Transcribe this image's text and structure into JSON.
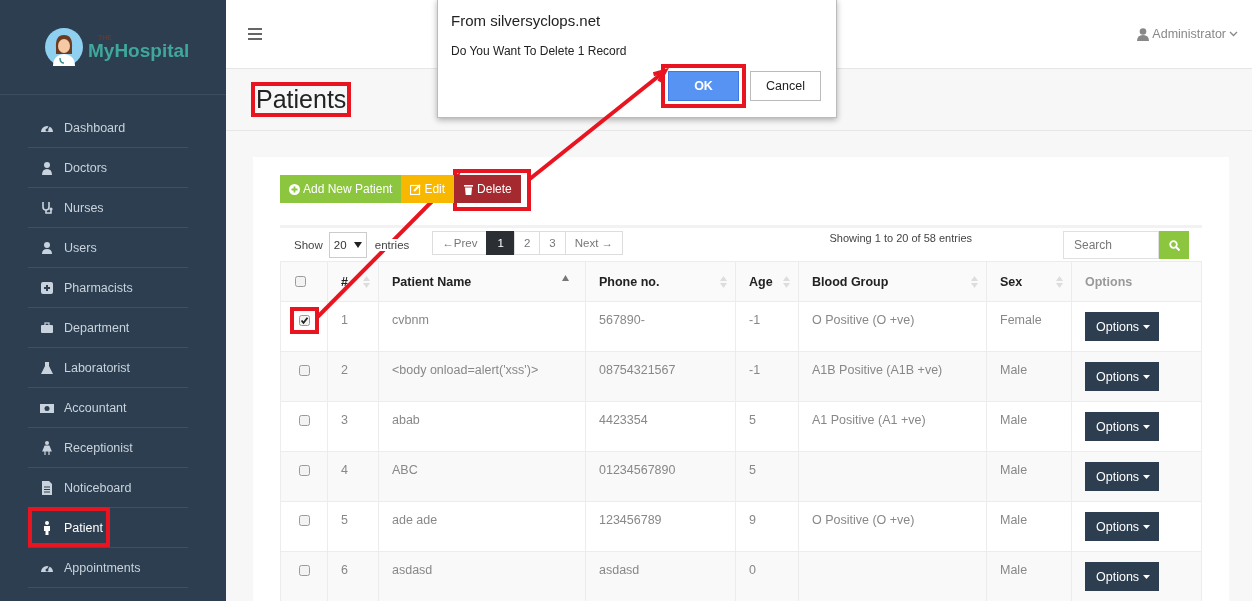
{
  "sidebar": {
    "logo": {
      "tagline": "THE",
      "text": "MyHospital"
    },
    "items": [
      {
        "label": "Dashboard",
        "selected": false,
        "highlighted": false
      },
      {
        "label": "Doctors",
        "selected": false,
        "highlighted": false
      },
      {
        "label": "Nurses",
        "selected": false,
        "highlighted": false
      },
      {
        "label": "Users",
        "selected": false,
        "highlighted": false
      },
      {
        "label": "Pharmacists",
        "selected": false,
        "highlighted": false
      },
      {
        "label": "Department",
        "selected": false,
        "highlighted": false
      },
      {
        "label": "Laboratorist",
        "selected": false,
        "highlighted": false
      },
      {
        "label": "Accountant",
        "selected": false,
        "highlighted": false
      },
      {
        "label": "Receptionist",
        "selected": false,
        "highlighted": false
      },
      {
        "label": "Noticeboard",
        "selected": false,
        "highlighted": false
      },
      {
        "label": "Patient",
        "selected": true,
        "highlighted": true
      },
      {
        "label": "Appointments",
        "selected": false,
        "highlighted": false
      }
    ]
  },
  "topbar": {
    "user": "Administrator"
  },
  "page": {
    "title": "Patients",
    "highlighted": true
  },
  "toolbar": [
    {
      "kind": "add",
      "label": "Add New Patient",
      "highlighted": false,
      "arrow": false
    },
    {
      "kind": "edit",
      "label": "Edit",
      "highlighted": false,
      "arrow": false
    },
    {
      "kind": "delete",
      "label": "Delete",
      "highlighted": true,
      "arrow": true
    }
  ],
  "length_menu": {
    "before": "Show",
    "value": "20",
    "after": "entries"
  },
  "pagination": [
    {
      "label": "←Prev",
      "selected": false
    },
    {
      "label": "1",
      "selected": true
    },
    {
      "label": "2",
      "selected": false
    },
    {
      "label": "3",
      "selected": false
    },
    {
      "label": "Next →",
      "selected": false
    }
  ],
  "info": "Showing 1 to 20 of 58 entries",
  "search": {
    "placeholder": "Search"
  },
  "table": {
    "select_all": {
      "checked": false
    },
    "columns": [
      {
        "kind": "text",
        "label": "#",
        "sortable": true,
        "sorted": false
      },
      {
        "kind": "text",
        "label": "Patient Name",
        "sortable": true,
        "sorted": true
      },
      {
        "kind": "text",
        "label": "Phone no.",
        "sortable": true,
        "sorted": false
      },
      {
        "kind": "text",
        "label": "Age",
        "sortable": true,
        "sorted": false
      },
      {
        "kind": "text",
        "label": "Blood Group",
        "sortable": true,
        "sorted": false
      },
      {
        "kind": "text",
        "label": "Sex",
        "sortable": true,
        "sorted": false
      },
      {
        "kind": "muted",
        "label": "Options",
        "sortable": false,
        "sorted": false
      }
    ],
    "rows": [
      {
        "checked": true,
        "highlighted": true,
        "arrow": true,
        "cells": [
          "1",
          "cvbnm",
          "567890-",
          "-1",
          "O Positive (O +ve)",
          "Female"
        ],
        "action": "Options"
      },
      {
        "checked": false,
        "highlighted": false,
        "arrow": false,
        "cells": [
          "2",
          "<body onload=alert('xss')>",
          "08754321567",
          "-1",
          "A1B Positive (A1B +ve)",
          "Male"
        ],
        "action": "Options"
      },
      {
        "checked": false,
        "highlighted": false,
        "arrow": false,
        "cells": [
          "3",
          "abab",
          "4423354",
          "5",
          "A1 Positive (A1 +ve)",
          "Male"
        ],
        "action": "Options"
      },
      {
        "checked": false,
        "highlighted": false,
        "arrow": false,
        "cells": [
          "4",
          "ABC",
          "01234567890",
          "5",
          null,
          "Male"
        ],
        "action": "Options"
      },
      {
        "checked": false,
        "highlighted": false,
        "arrow": false,
        "cells": [
          "5",
          "ade ade",
          "123456789",
          "9",
          "O Positive (O +ve)",
          "Male"
        ],
        "action": "Options"
      },
      {
        "checked": false,
        "highlighted": false,
        "arrow": false,
        "cells": [
          "6",
          "asdasd",
          "asdasd",
          "0",
          null,
          "Male"
        ],
        "action": "Options"
      }
    ]
  },
  "dialog": {
    "title": "From silversyclops.net",
    "message": "Do You Want To Delete 1 Record",
    "buttons": [
      {
        "kind": "primary",
        "label": "OK",
        "highlighted": true
      },
      {
        "kind": "default",
        "label": "Cancel",
        "highlighted": false
      }
    ]
  }
}
